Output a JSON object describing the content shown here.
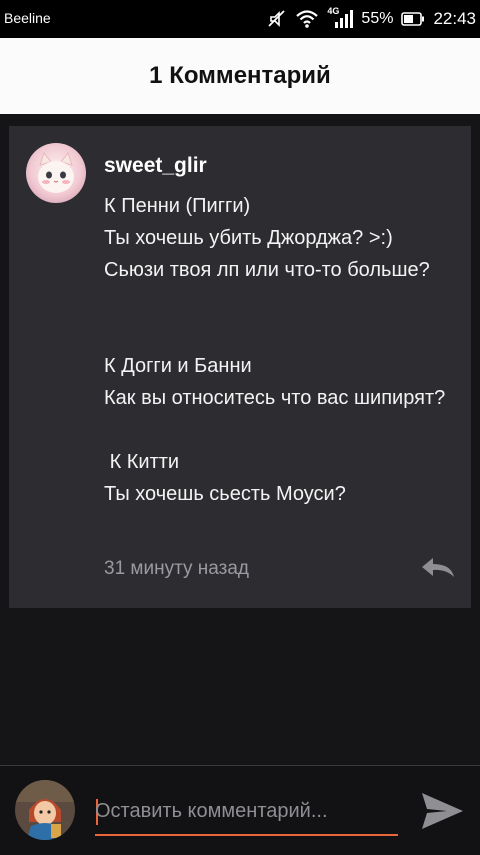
{
  "status_bar": {
    "carrier": "Beeline",
    "network_type": "4G",
    "battery": "55%",
    "time": "22:43",
    "icons": [
      "mute-icon",
      "wifi-icon",
      "signal-icon",
      "battery-icon"
    ]
  },
  "header": {
    "title": "1 Комментарий"
  },
  "comment": {
    "author": "sweet_glir",
    "text": "К Пенни (Пигги)\nТы хочешь убить Джорджа? >:)\nСьюзи твоя лп или что-то больше?\n\n\nК Догги и Банни\nКак вы относитесь что вас шипирят?\n\n К Китти\nТы хочешь сьесть Моуси?",
    "timestamp": "31 минуту назад",
    "reply_icon": "reply-icon"
  },
  "composer": {
    "placeholder": "Оставить комментарий...",
    "value": "",
    "send_icon": "send-icon"
  },
  "colors": {
    "background": "#151417",
    "card": "#2d2c30",
    "header_bg": "#fbfbfb",
    "accent": "#e8663a",
    "muted_text": "#9b9aa0"
  }
}
